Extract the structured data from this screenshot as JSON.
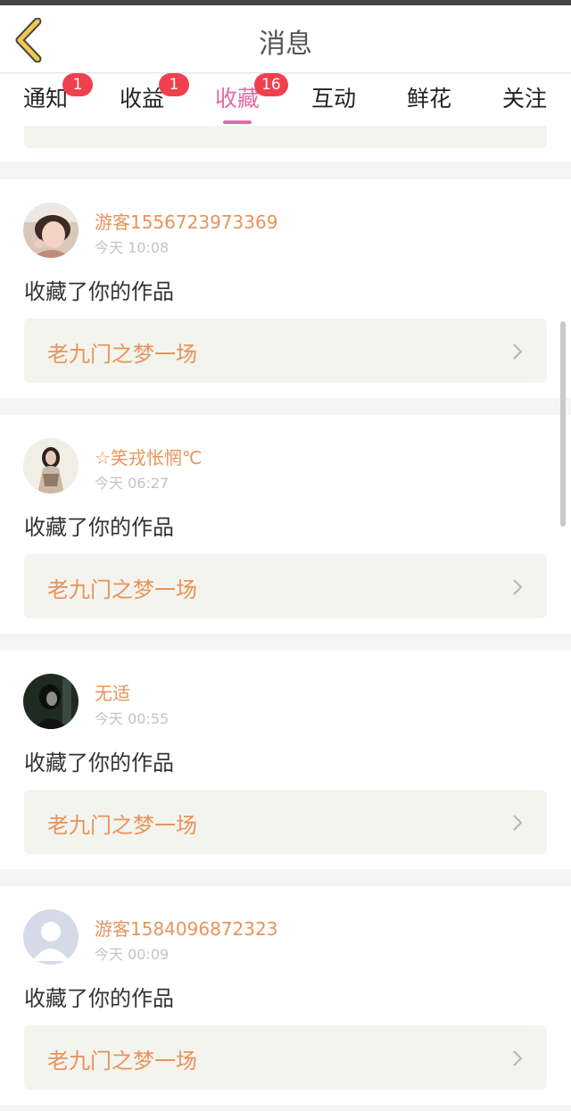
{
  "header": {
    "title": "消息"
  },
  "tabs": [
    {
      "label": "通知",
      "badge": "1"
    },
    {
      "label": "收益",
      "badge": "1"
    },
    {
      "label": "收藏",
      "badge": "16",
      "active": true
    },
    {
      "label": "互动"
    },
    {
      "label": "鲜花"
    },
    {
      "label": "关注"
    }
  ],
  "notifications": [
    {
      "user": "游客1556723973369",
      "time": "今天 10:08",
      "action": "收藏了你的作品",
      "work": "老九门之梦一场"
    },
    {
      "user": "☆笑戎怅惘℃",
      "time": "今天 06:27",
      "action": "收藏了你的作品",
      "work": "老九门之梦一场"
    },
    {
      "user": "无适",
      "time": "今天 00:55",
      "action": "收藏了你的作品",
      "work": "老九门之梦一场"
    },
    {
      "user": "游客1584096872323",
      "time": "今天 00:09",
      "action": "收藏了你的作品",
      "work": "老九门之梦一场"
    }
  ],
  "colors": {
    "accent_pink": "#e46aa6",
    "badge_red": "#f0404e",
    "username_orange": "#e8935a",
    "back_arrow_yellow": "#f2c94c"
  },
  "icons": {
    "back": "chevron-left-icon",
    "item": "chevron-right-icon"
  }
}
